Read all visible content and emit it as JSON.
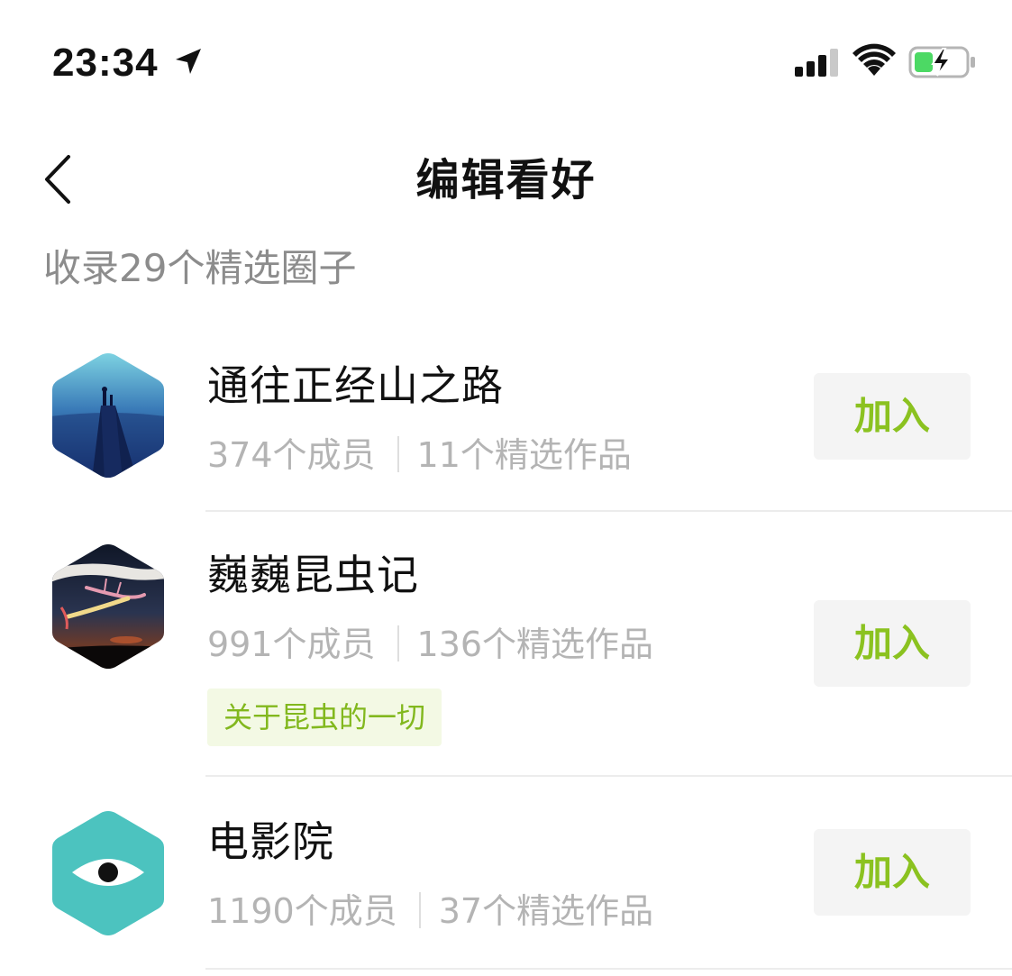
{
  "status_bar": {
    "time": "23:34",
    "icons": [
      "location-arrow-icon",
      "cellular-signal-icon",
      "wifi-icon",
      "battery-charging-icon"
    ],
    "battery_color": "#4cd964"
  },
  "nav": {
    "title": "编辑看好",
    "back_icon": "chevron-left-icon"
  },
  "section": {
    "caption": "收录29个精选圈子"
  },
  "colors": {
    "accent_green": "#8bc220",
    "tag_bg": "#f3f9e4",
    "muted_text": "#b4b4b4",
    "avatar_teal": "#4cc3bf"
  },
  "circles": [
    {
      "name": "通往正经山之路",
      "members": "374个成员",
      "works": "11个精选作品",
      "tag": "",
      "join_label": "加入",
      "avatar": "mountain-photo-avatar"
    },
    {
      "name": "巍巍昆虫记",
      "members": "991个成员",
      "works": "136个精选作品",
      "tag": "关于昆虫的一切",
      "join_label": "加入",
      "avatar": "insect-photo-avatar"
    },
    {
      "name": "电影院",
      "members": "1190个成员",
      "works": "37个精选作品",
      "tag": "",
      "join_label": "加入",
      "avatar": "eye-icon-avatar"
    }
  ]
}
